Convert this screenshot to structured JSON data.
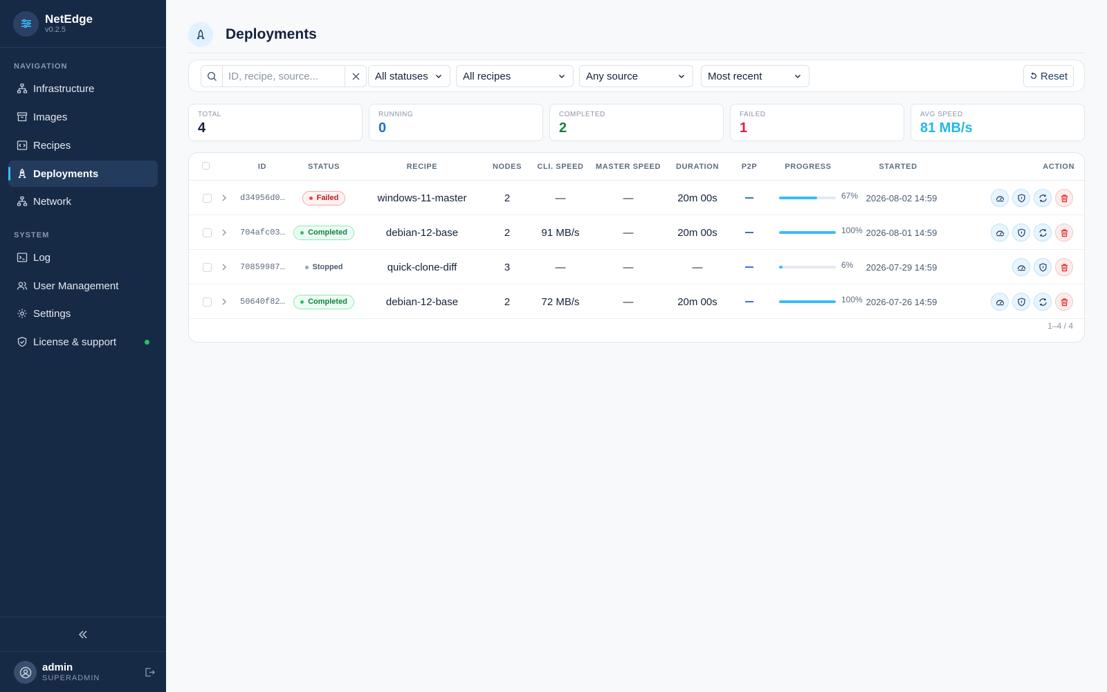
{
  "app": {
    "name": "NetEdge",
    "version": "v0.2.5"
  },
  "sidebar": {
    "nav_title": "NAVIGATION",
    "nav_items": [
      {
        "label": "Infrastructure",
        "icon": "sitemap-icon"
      },
      {
        "label": "Images",
        "icon": "archive-icon"
      },
      {
        "label": "Recipes",
        "icon": "recipe-icon"
      },
      {
        "label": "Deployments",
        "icon": "rocket-icon",
        "active": true
      },
      {
        "label": "Network",
        "icon": "network-icon"
      }
    ],
    "system_title": "SYSTEM",
    "system_items": [
      {
        "label": "Log",
        "icon": "terminal-icon"
      },
      {
        "label": "User Management",
        "icon": "users-icon"
      },
      {
        "label": "Settings",
        "icon": "gear-icon"
      },
      {
        "label": "License & support",
        "icon": "shield-check-icon",
        "status_color": "#22c55e"
      }
    ],
    "user": {
      "name": "admin",
      "role": "SUPERADMIN"
    }
  },
  "page": {
    "title": "Deployments"
  },
  "filters": {
    "search_placeholder": "ID, recipe, source...",
    "status": "All statuses",
    "recipe": "All recipes",
    "source": "Any source",
    "sort": "Most recent",
    "reset_label": "Reset"
  },
  "stats": [
    {
      "label": "TOTAL",
      "value": "4",
      "color": "#14213a"
    },
    {
      "label": "RUNNING",
      "value": "0",
      "color": "#1d6fd6"
    },
    {
      "label": "COMPLETED",
      "value": "2",
      "color": "#15803d"
    },
    {
      "label": "FAILED",
      "value": "1",
      "color": "#e11d48"
    },
    {
      "label": "AVG SPEED",
      "value": "81 MB/s",
      "color": "#22b8e6"
    }
  ],
  "table": {
    "headers": {
      "id": "ID",
      "status": "STATUS",
      "recipe": "RECIPE",
      "nodes": "NODES",
      "cli_speed": "CLI. SPEED",
      "master_speed": "MASTER SPEED",
      "duration": "DURATION",
      "p2p": "P2P",
      "progress": "PROGRESS",
      "started": "STARTED",
      "action": "ACTION"
    },
    "rows": [
      {
        "id": "d34956d0…",
        "status": "Failed",
        "status_kind": "failed",
        "recipe": "windows-11-master",
        "nodes": "2",
        "cli_speed": "—",
        "master_speed": "—",
        "duration": "20m 00s",
        "progress": 67,
        "progress_label": "67%",
        "started": "2026-08-02 14:59",
        "actions": [
          "dashboard-icon",
          "shield-icon",
          "refresh-icon",
          "trash-icon"
        ]
      },
      {
        "id": "704afc03…",
        "status": "Completed",
        "status_kind": "completed",
        "recipe": "debian-12-base",
        "nodes": "2",
        "cli_speed": "91 MB/s",
        "master_speed": "—",
        "duration": "20m 00s",
        "progress": 100,
        "progress_label": "100%",
        "started": "2026-08-01 14:59",
        "actions": [
          "dashboard-icon",
          "shield-icon",
          "refresh-icon",
          "trash-icon"
        ]
      },
      {
        "id": "70859987…",
        "status": "Stopped",
        "status_kind": "stopped",
        "recipe": "quick-clone-diff",
        "nodes": "3",
        "cli_speed": "—",
        "master_speed": "—",
        "duration": "—",
        "progress": 6,
        "progress_label": "6%",
        "started": "2026-07-29 14:59",
        "actions": [
          "dashboard-icon",
          "shield-icon",
          "trash-icon"
        ]
      },
      {
        "id": "50640f82…",
        "status": "Completed",
        "status_kind": "completed",
        "recipe": "debian-12-base",
        "nodes": "2",
        "cli_speed": "72 MB/s",
        "master_speed": "—",
        "duration": "20m 00s",
        "progress": 100,
        "progress_label": "100%",
        "started": "2026-07-26 14:59",
        "actions": [
          "dashboard-icon",
          "shield-icon",
          "refresh-icon",
          "trash-icon"
        ]
      }
    ],
    "pager": "1–4 / 4"
  }
}
